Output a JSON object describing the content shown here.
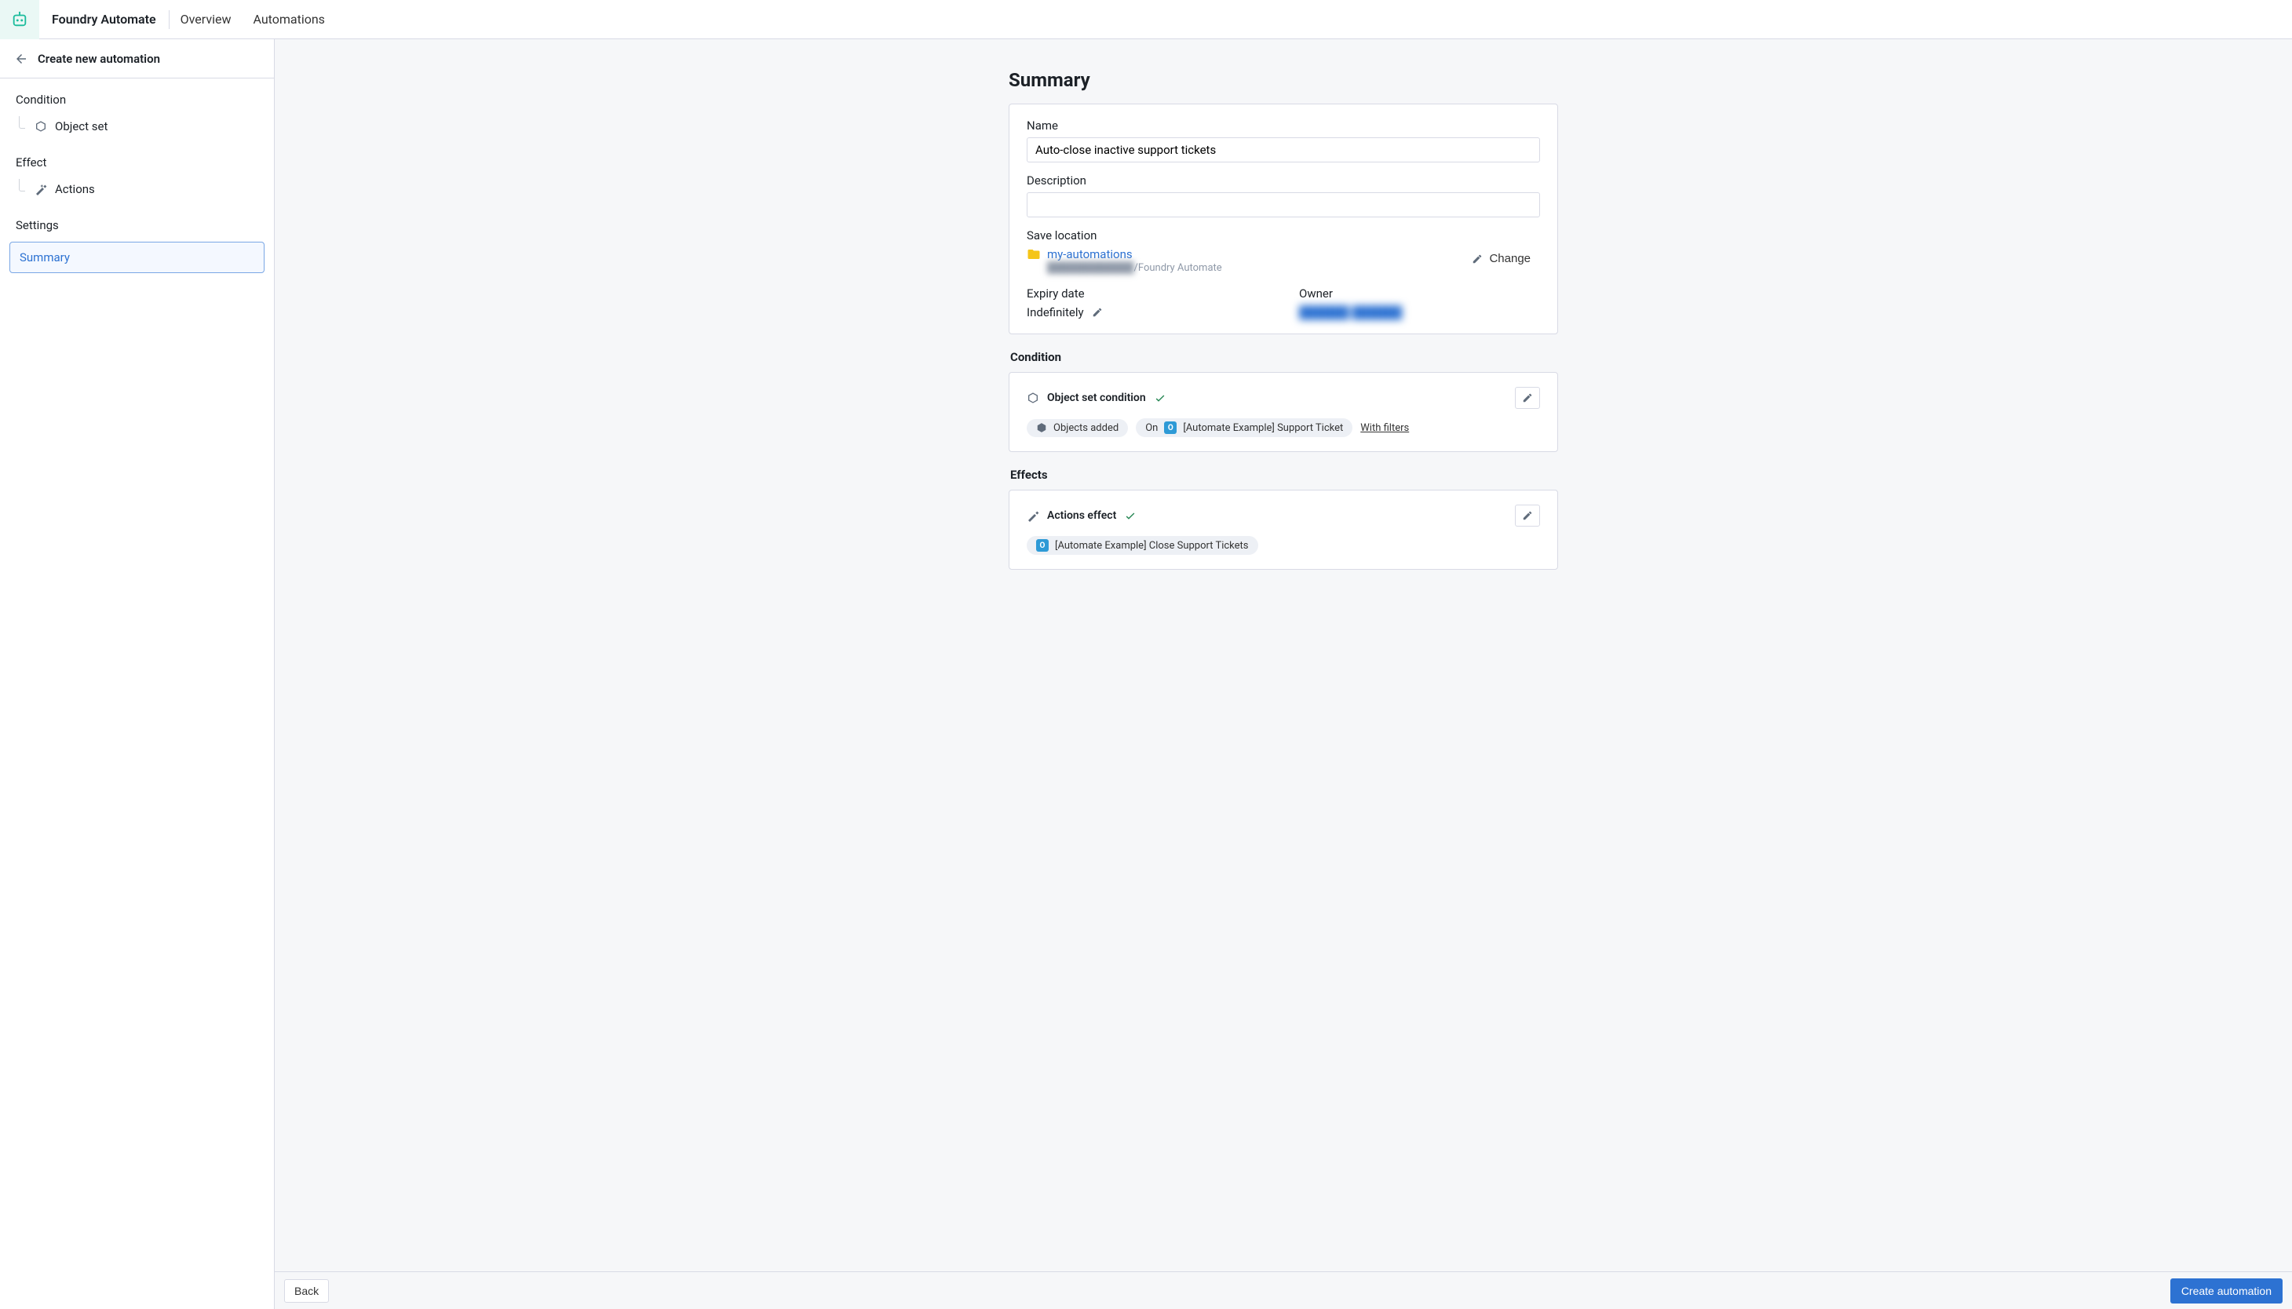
{
  "header": {
    "product_name": "Foundry Automate",
    "tab_overview": "Overview",
    "tab_automations": "Automations"
  },
  "sidebar": {
    "page_title": "Create new automation",
    "condition_label": "Condition",
    "object_set_label": "Object set",
    "effect_label": "Effect",
    "actions_label": "Actions",
    "settings_label": "Settings",
    "summary_label": "Summary"
  },
  "main": {
    "title": "Summary",
    "name_label": "Name",
    "name_value": "Auto-close inactive support tickets",
    "description_label": "Description",
    "description_value": "",
    "save_location_label": "Save location",
    "folder_name": "my-automations",
    "folder_path_hidden": "████████████",
    "folder_path_suffix": "/Foundry Automate",
    "change_label": "Change",
    "expiry_label": "Expiry date",
    "expiry_value": "Indefinitely",
    "owner_label": "Owner",
    "owner_value_hidden": "██████ ██████",
    "condition_section": "Condition",
    "effects_section": "Effects",
    "object_set_condition": "Object set condition",
    "chip_objects_added": "Objects added",
    "chip_on": "On",
    "chip_object_type": "[Automate Example] Support Ticket",
    "with_filters": "With filters",
    "actions_effect": "Actions effect",
    "chip_action": "[Automate Example] Close Support Tickets"
  },
  "footer": {
    "back": "Back",
    "create": "Create automation"
  }
}
